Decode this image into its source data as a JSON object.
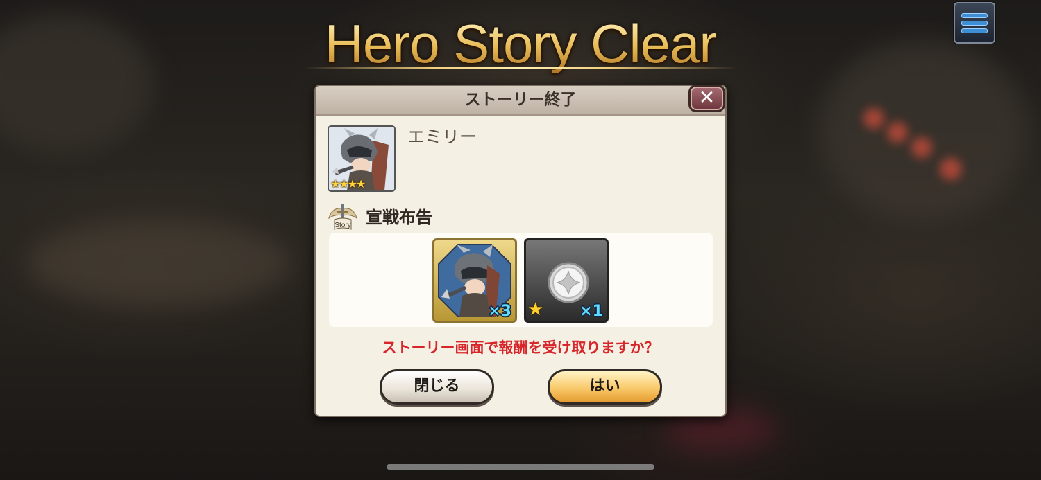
{
  "banner": {
    "title": "Hero Story Clear"
  },
  "menu": {
    "icon": "hamburger-menu-icon"
  },
  "dialog": {
    "title": "ストーリー終了",
    "close_icon": "close-x-icon",
    "hero": {
      "name": "エミリー",
      "stars": "★★★★",
      "rarity": 4
    },
    "story": {
      "icon": "story-sword-icon",
      "icon_label": "Story",
      "chapter": "宣戦布告"
    },
    "rewards": [
      {
        "kind": "hero-medal",
        "quantity": "×3"
      },
      {
        "kind": "silver-crystal",
        "star": "★",
        "quantity": "×1"
      }
    ],
    "prompt": "ストーリー画面で報酬を受け取りますか？",
    "buttons": {
      "close": "閉じる",
      "yes": "はい"
    }
  },
  "colors": {
    "prompt": "#d7252a",
    "title_gold": "#f1cf7d",
    "yes_button": "#f9c96a",
    "quantity": "#5fdcff"
  }
}
